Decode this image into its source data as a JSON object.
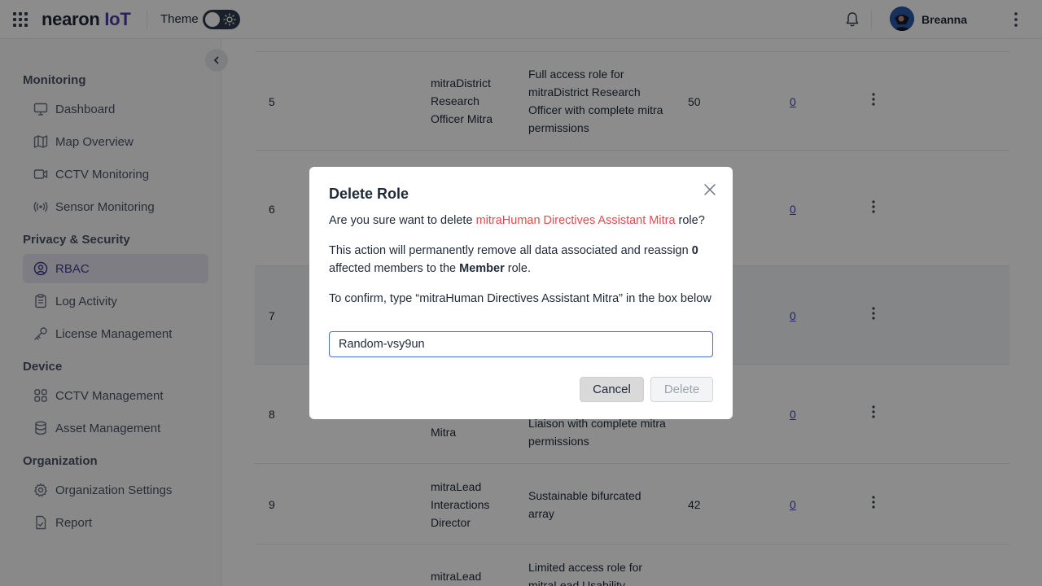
{
  "header": {
    "logo_main": "nearon",
    "logo_accent": "IoT",
    "theme_label": "Theme",
    "user_name": "Breanna"
  },
  "sidebar": {
    "sections": [
      {
        "title": "Monitoring",
        "items": [
          "Dashboard",
          "Map Overview",
          "CCTV Monitoring",
          "Sensor Monitoring"
        ]
      },
      {
        "title": "Privacy & Security",
        "items": [
          "RBAC",
          "Log Activity",
          "License Management"
        ]
      },
      {
        "title": "Device",
        "items": [
          "CCTV Management",
          "Asset Management"
        ]
      },
      {
        "title": "Organization",
        "items": [
          "Organization Settings",
          "Report"
        ]
      }
    ],
    "active_item": "RBAC"
  },
  "table": {
    "rows": [
      {
        "num": "5",
        "name": "mitraDistrict Research Officer Mitra",
        "desc": "Full access role for mitraDistrict Research Officer with complete mitra permissions",
        "level": "50",
        "members": "0"
      },
      {
        "num": "6",
        "name": "",
        "desc": "",
        "level": "",
        "members": "0"
      },
      {
        "num": "7",
        "name": "",
        "desc": "",
        "level": "",
        "members": "0"
      },
      {
        "num": "8",
        "name": "Mitra",
        "desc": "Liaison with complete mitra permissions",
        "level": "",
        "members": "0"
      },
      {
        "num": "9",
        "name": "mitraLead Interactions Director",
        "desc": "Sustainable bifurcated array",
        "level": "42",
        "members": "0"
      },
      {
        "num": "",
        "name": "mitraLead",
        "desc": "Limited access role for mitraLead Usability",
        "level": "",
        "members": ""
      }
    ]
  },
  "modal": {
    "title": "Delete Role",
    "question_prefix": "Are you sure want to delete ",
    "role_name": "mitraHuman Directives Assistant Mitra",
    "question_suffix": " role?",
    "warning_prefix": "This action will permanently remove all data associated and reassign ",
    "affected_count": "0",
    "warning_middle": " affected members to the ",
    "target_role": "Member",
    "warning_suffix": " role.",
    "confirm_text": "To confirm, type “mitraHuman Directives Assistant Mitra” in the box below",
    "input_value": "Random-vsy9un",
    "cancel_label": "Cancel",
    "delete_label": "Delete"
  },
  "colors": {
    "accent": "#3f3f8f",
    "danger": "#e5484d",
    "overlay": "rgba(0,0,0,0.45)"
  }
}
